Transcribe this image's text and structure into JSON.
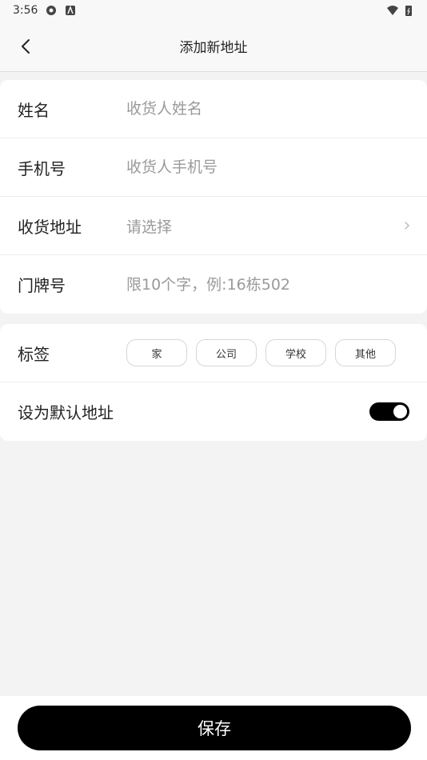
{
  "status_bar": {
    "time": "3:56"
  },
  "header": {
    "title": "添加新地址"
  },
  "form": {
    "name": {
      "label": "姓名",
      "placeholder": "收货人姓名",
      "value": ""
    },
    "phone": {
      "label": "手机号",
      "placeholder": "收货人手机号",
      "value": ""
    },
    "address": {
      "label": "收货地址",
      "placeholder": "请选择"
    },
    "door": {
      "label": "门牌号",
      "placeholder": "限10个字，例:16栋502",
      "value": ""
    }
  },
  "tags": {
    "label": "标签",
    "items": [
      "家",
      "公司",
      "学校",
      "其他"
    ]
  },
  "default_address": {
    "label": "设为默认地址",
    "enabled": true
  },
  "save": {
    "label": "保存"
  },
  "colors": {
    "primary": "#000000",
    "background": "#f3f3f3",
    "placeholder": "#9a9a9a"
  }
}
